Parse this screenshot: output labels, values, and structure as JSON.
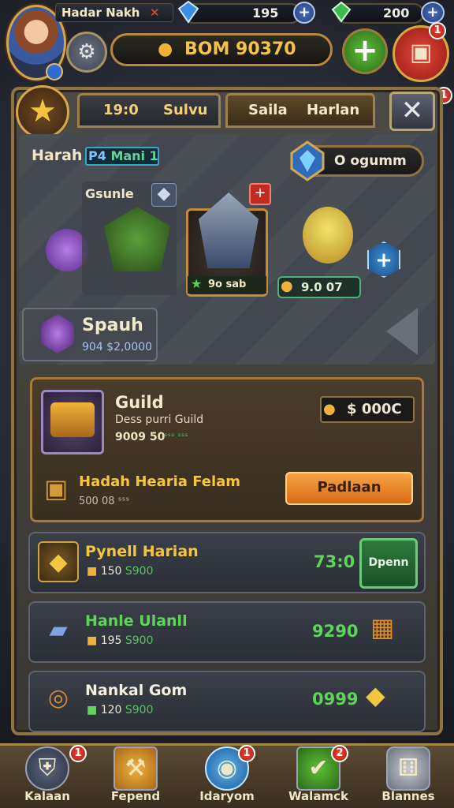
{
  "player": {
    "name": "Hadar Nakh",
    "name_suffix": "✕",
    "gems": "195",
    "energy": "200",
    "gold": "BOM 90370"
  },
  "header": {
    "tab1_left": "19:0",
    "tab1_right": "Sulvu",
    "tab2_left": "Saila",
    "tab2_right": "Harlan",
    "close_label": "✕"
  },
  "hero": {
    "label": "Harah",
    "badge_prefix": "P4",
    "badge_text": "Mani 1",
    "gem_pill": "O ogumm",
    "left_label": "Gsunle",
    "mid_label": "9o sab",
    "small_pill": "9.0 07",
    "spauh_title": "Spauh",
    "spauh_sub": "904 $2,0000"
  },
  "guild": {
    "title": "Guild",
    "subtitle": "Dess purri Guild",
    "meta": "9009 50",
    "meta_green": "ˢˢˢ ˢˢˢ",
    "price_prefix": "$",
    "price": "000C",
    "row_title": "Hadah Hearia Felam",
    "row_sub": "500 08 ˢˢˢ",
    "button_label": "Padlaan"
  },
  "rows": [
    {
      "title": "Pynell Harian",
      "sub_a": "150",
      "sub_b": "S900",
      "value": "73:0",
      "button": "Dpenn",
      "title_color": "#f5c542"
    },
    {
      "title": "Hanle Ulanll",
      "sub_a": "195",
      "sub_b": "S900",
      "value": "9290",
      "title_color": "#5fd35a"
    },
    {
      "title": "Nankal Gom",
      "sub_a": "120",
      "sub_b": "S900",
      "value": "0999",
      "title_color": "#f5efe0"
    }
  ],
  "nav": [
    {
      "label": "Kalaan",
      "badge": "1"
    },
    {
      "label": "Fepend",
      "badge": ""
    },
    {
      "label": "Idaryom",
      "badge": "1"
    },
    {
      "label": "Walamck",
      "badge": "2"
    },
    {
      "label": "Blannes",
      "badge": ""
    }
  ],
  "badges": {
    "chest": "1",
    "right_edge": "1"
  }
}
